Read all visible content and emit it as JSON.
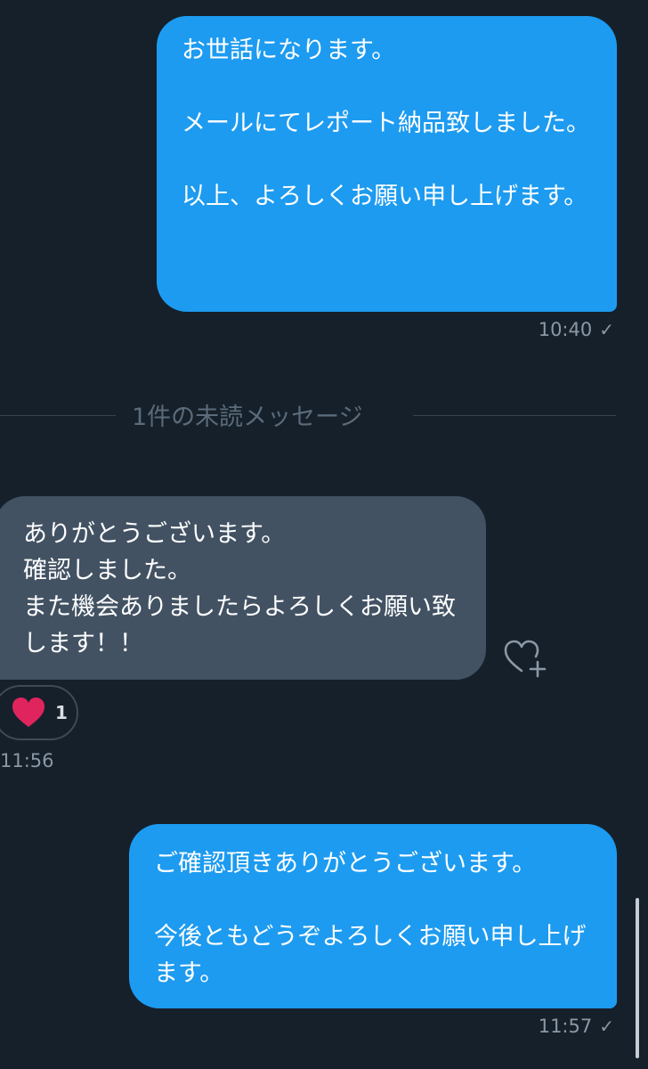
{
  "messages": [
    {
      "text": "お世話になります。\n\nメールにてレポート納品致しました。\n\n以上、よろしくお願い申し上げます。",
      "time": "10:40",
      "status": "✓"
    },
    {
      "text": "ありがとうございます。\n確認しました。\nまた機会ありましたらよろしくお願い致します！！",
      "time": "11:56",
      "reaction": {
        "emoji": "heart-icon",
        "count": "1"
      }
    },
    {
      "text": "ご確認頂きありがとうございます。\n\n今後ともどうぞよろしくお願い申し上げます。",
      "time": "11:57",
      "status": "✓"
    }
  ],
  "divider": {
    "label": "1件の未読メッセージ"
  },
  "colors": {
    "background": "#15202b",
    "outgoing_bubble": "#1d9bf0",
    "incoming_bubble": "#425263",
    "heart": "#e0245e",
    "muted_text": "#8b98a5"
  }
}
